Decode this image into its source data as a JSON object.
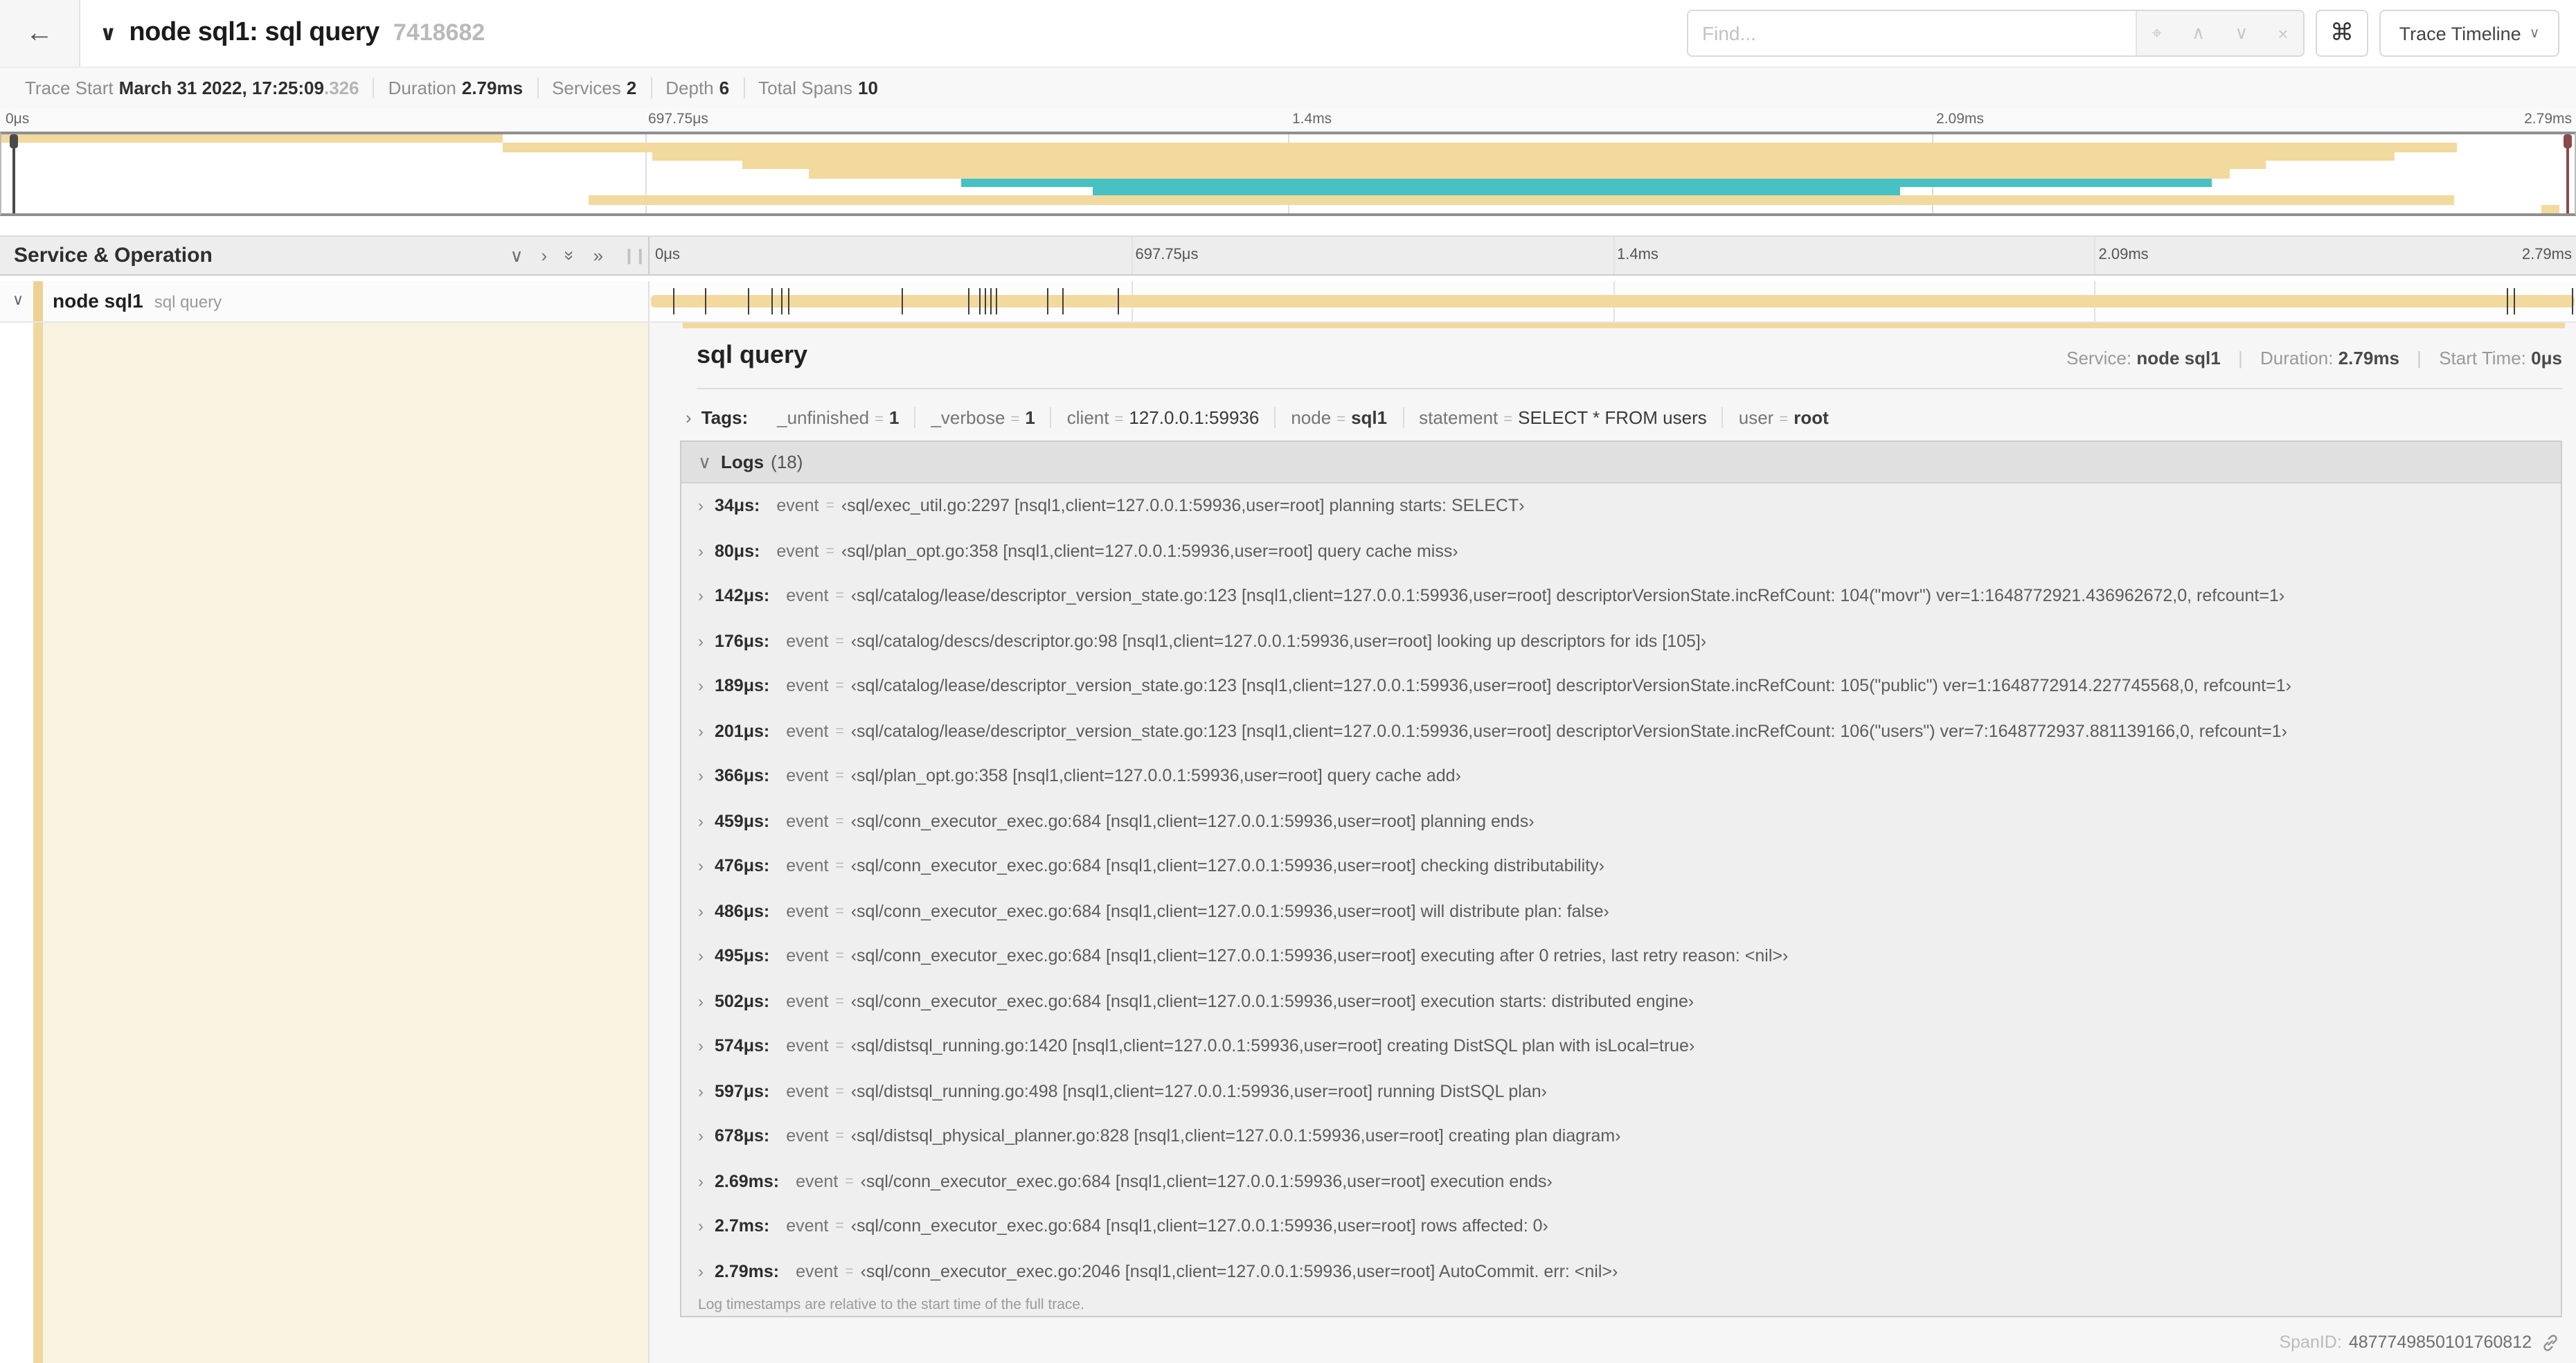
{
  "icons": {
    "back": "←",
    "collapse": "∨",
    "target": "⌖",
    "prev": "∧",
    "next": "∨",
    "clear": "×",
    "command": "⌘",
    "caret": "∨",
    "chev_down": "∨",
    "chev_right": "›",
    "dbl_chev": "»"
  },
  "header": {
    "title": "node sql1: sql query",
    "trace_id_short": "7418682",
    "find_placeholder": "Find...",
    "view_selector": "Trace Timeline"
  },
  "summary": {
    "items": [
      {
        "label": "Trace Start",
        "value": "March 31 2022, 17:25:09",
        "suffix": ".326"
      },
      {
        "label": "Duration",
        "value": "2.79ms"
      },
      {
        "label": "Services",
        "value": "2"
      },
      {
        "label": "Depth",
        "value": "6"
      },
      {
        "label": "Total Spans",
        "value": "10"
      }
    ]
  },
  "timeline": {
    "ticks": [
      "0μs",
      "697.75μs",
      "1.4ms",
      "2.09ms",
      "2.79ms"
    ]
  },
  "minimap": {
    "colors": {
      "tan": "#F2D99E",
      "teal": "#47C1C3"
    },
    "spans": [
      {
        "start": 0,
        "end": 19.5,
        "color": "tan"
      },
      {
        "start": 19.5,
        "end": 95.4,
        "color": "tan"
      },
      {
        "start": 25.3,
        "end": 93.0,
        "color": "tan"
      },
      {
        "start": 28.8,
        "end": 88.0,
        "color": "tan"
      },
      {
        "start": 31.4,
        "end": 86.6,
        "color": "tan"
      },
      {
        "start": 37.3,
        "end": 85.9,
        "color": "teal"
      },
      {
        "start": 42.4,
        "end": 73.8,
        "color": "teal"
      },
      {
        "start": 22.8,
        "end": 95.3,
        "color": "tan"
      },
      {
        "start": 98.7,
        "end": 99.4,
        "color": "tan"
      }
    ]
  },
  "left_panel": {
    "title": "Service & Operation",
    "service": "node sql1",
    "operation": "sql query"
  },
  "gantt": {
    "tick_positions": [
      1.2,
      2.9,
      5.1,
      6.3,
      6.8,
      7.2,
      13.1,
      16.5,
      17.1,
      17.4,
      17.7,
      18.0,
      20.6,
      21.4,
      24.3,
      96.4,
      96.8,
      99.8
    ]
  },
  "detail": {
    "title": "sql query",
    "meta": {
      "service_label": "Service:",
      "service": "node sql1",
      "duration_label": "Duration:",
      "duration": "2.79ms",
      "start_label": "Start Time:",
      "start": "0μs"
    },
    "tags": {
      "label": "Tags:",
      "eq": "=",
      "items": [
        {
          "key": "_unfinished",
          "value": "1",
          "bold": true
        },
        {
          "key": "_verbose",
          "value": "1",
          "bold": true
        },
        {
          "key": "client",
          "value": "127.0.0.1:59936",
          "bold": false
        },
        {
          "key": "node",
          "value": "sql1",
          "bold": true
        },
        {
          "key": "statement",
          "value": "SELECT * FROM users",
          "bold": false
        },
        {
          "key": "user",
          "value": "root",
          "bold": true
        }
      ]
    },
    "logs": {
      "label": "Logs",
      "count": "(18)",
      "field_label": "event",
      "eq": "=",
      "entries": [
        {
          "time": "34μs:",
          "value": "‹sql/exec_util.go:2297 [nsql1,client=127.0.0.1:59936,user=root] planning starts: SELECT›"
        },
        {
          "time": "80μs:",
          "value": "‹sql/plan_opt.go:358 [nsql1,client=127.0.0.1:59936,user=root] query cache miss›"
        },
        {
          "time": "142μs:",
          "value": "‹sql/catalog/lease/descriptor_version_state.go:123 [nsql1,client=127.0.0.1:59936,user=root] descriptorVersionState.incRefCount: 104(\"movr\") ver=1:1648772921.436962672,0, refcount=1›"
        },
        {
          "time": "176μs:",
          "value": "‹sql/catalog/descs/descriptor.go:98 [nsql1,client=127.0.0.1:59936,user=root] looking up descriptors for ids [105]›"
        },
        {
          "time": "189μs:",
          "value": "‹sql/catalog/lease/descriptor_version_state.go:123 [nsql1,client=127.0.0.1:59936,user=root] descriptorVersionState.incRefCount: 105(\"public\") ver=1:1648772914.227745568,0, refcount=1›"
        },
        {
          "time": "201μs:",
          "value": "‹sql/catalog/lease/descriptor_version_state.go:123 [nsql1,client=127.0.0.1:59936,user=root] descriptorVersionState.incRefCount: 106(\"users\") ver=7:1648772937.881139166,0, refcount=1›"
        },
        {
          "time": "366μs:",
          "value": "‹sql/plan_opt.go:358 [nsql1,client=127.0.0.1:59936,user=root] query cache add›"
        },
        {
          "time": "459μs:",
          "value": "‹sql/conn_executor_exec.go:684 [nsql1,client=127.0.0.1:59936,user=root] planning ends›"
        },
        {
          "time": "476μs:",
          "value": "‹sql/conn_executor_exec.go:684 [nsql1,client=127.0.0.1:59936,user=root] checking distributability›"
        },
        {
          "time": "486μs:",
          "value": "‹sql/conn_executor_exec.go:684 [nsql1,client=127.0.0.1:59936,user=root] will distribute plan: false›"
        },
        {
          "time": "495μs:",
          "value": "‹sql/conn_executor_exec.go:684 [nsql1,client=127.0.0.1:59936,user=root] executing after 0 retries, last retry reason: <nil>›"
        },
        {
          "time": "502μs:",
          "value": "‹sql/conn_executor_exec.go:684 [nsql1,client=127.0.0.1:59936,user=root] execution starts: distributed engine›"
        },
        {
          "time": "574μs:",
          "value": "‹sql/distsql_running.go:1420 [nsql1,client=127.0.0.1:59936,user=root] creating DistSQL plan with isLocal=true›"
        },
        {
          "time": "597μs:",
          "value": "‹sql/distsql_running.go:498 [nsql1,client=127.0.0.1:59936,user=root] running DistSQL plan›"
        },
        {
          "time": "678μs:",
          "value": "‹sql/distsql_physical_planner.go:828 [nsql1,client=127.0.0.1:59936,user=root] creating plan diagram›"
        },
        {
          "time": "2.69ms:",
          "value": "‹sql/conn_executor_exec.go:684 [nsql1,client=127.0.0.1:59936,user=root] execution ends›"
        },
        {
          "time": "2.7ms:",
          "value": "‹sql/conn_executor_exec.go:684 [nsql1,client=127.0.0.1:59936,user=root] rows affected: 0›"
        },
        {
          "time": "2.79ms:",
          "value": "‹sql/conn_executor_exec.go:2046 [nsql1,client=127.0.0.1:59936,user=root] AutoCommit. err: <nil>›"
        }
      ],
      "note": "Log timestamps are relative to the start time of the full trace."
    },
    "footer": {
      "label": "SpanID:",
      "value": "4877749850101760812"
    }
  }
}
